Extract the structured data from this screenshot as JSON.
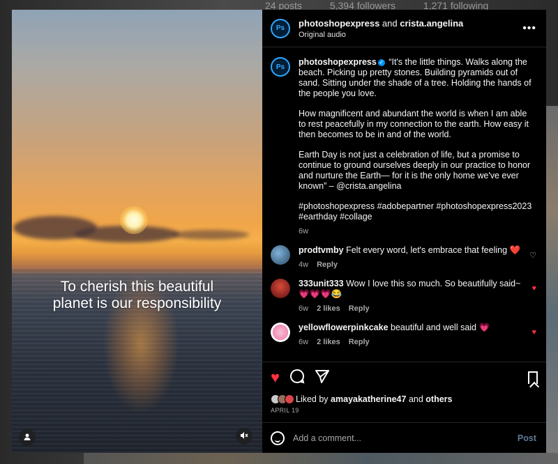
{
  "background": {
    "posts": "24 posts",
    "followers": "5,394 followers",
    "following": "1,271 following"
  },
  "media": {
    "overlay_line1": "To cherish this beautiful",
    "overlay_line2": "planet is our responsibility",
    "tag_people_icon": "person-icon",
    "mute_icon": "muted-speaker-icon"
  },
  "header": {
    "user1": "photoshopexpress",
    "and": " and ",
    "user2": "crista.angelina",
    "audio": "Original audio",
    "avatar_text": "Ps"
  },
  "caption": {
    "username": "photoshopexpress",
    "avatar_text": "Ps",
    "verified": "✓",
    "p1": "“It's the little things. Walks along the beach. Picking up pretty stones. Building pyramids out of sand. Sitting under the shade of a tree. Holding the hands of the people you love.",
    "p2": "How magnificent and abundant the world is when I am able to rest peacefully in my connection to the earth. How easy it then becomes to be in and of the world.",
    "p3": "Earth Day is not just a celebration of life, but a promise to continue to ground ourselves deeply in our practice to honor and nurture the Earth— for it is the only home we've ever known” – @crista.angelina",
    "p4": "#photoshopexpress #adobepartner #photoshopexpress2023 #earthday #collage",
    "time": "6w"
  },
  "comments": [
    {
      "username": "prodtvmby",
      "text": "Felt every word, let's embrace that feeling ❤️",
      "time": "4w",
      "likes": "",
      "reply": "Reply"
    },
    {
      "username": "333unit333",
      "text": "Wow I love this so much. So beautifully said~ 💗💗💗😂",
      "time": "6w",
      "likes": "2 likes",
      "reply": "Reply"
    },
    {
      "username": "yellowflowerpinkcake",
      "text": "beautiful and well said 💗",
      "time": "6w",
      "likes": "2 likes",
      "reply": "Reply"
    }
  ],
  "actions": {
    "liked_by_prefix": "Liked by ",
    "liked_by_user": "amayakatherine47",
    "liked_by_and": " and ",
    "liked_by_others": "others",
    "date": "APRIL 19"
  },
  "add_comment": {
    "placeholder": "Add a comment...",
    "post_label": "Post"
  },
  "colors": {
    "like_red": "#ff3040",
    "verified_blue": "#0095f6",
    "post_disabled": "#5d7a96"
  }
}
